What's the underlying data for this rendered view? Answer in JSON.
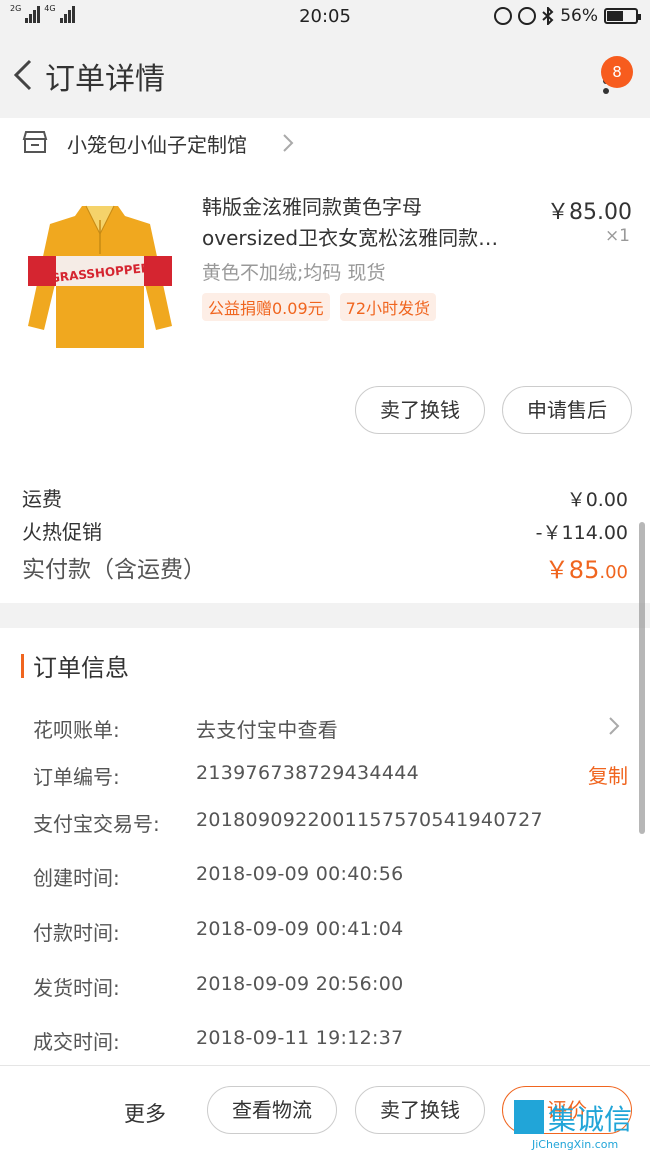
{
  "status_bar": {
    "network_1": "2G",
    "network_2": "4G",
    "time": "20:05",
    "battery": "56%",
    "battery_level": 0.56
  },
  "nav": {
    "title": "订单详情",
    "badge_count": "8"
  },
  "shop": {
    "name": "小笼包小仙子定制馆"
  },
  "product": {
    "title_line1": "韩版金泫雅同款黄色字母",
    "title_line2": "oversized卫衣女宽松泫雅同款…",
    "price": "￥85.00",
    "quantity": "×1",
    "spec": "黄色不加绒;均码 现货",
    "tags": [
      "公益捐赠0.09元",
      "72小时发货"
    ],
    "image_text": "GRASSHOPPER",
    "image_color": "#f0a81f"
  },
  "item_actions": {
    "sell_label": "卖了换钱",
    "after_sale_label": "申请售后"
  },
  "fees": {
    "shipping_label": "运费",
    "shipping_value": "￥0.00",
    "promo_label": "火热促销",
    "promo_value": "-￥114.00",
    "paid_label": "实付款（含运费）",
    "paid_value_main": "￥85",
    "paid_value_decimal": ".00"
  },
  "order_info": {
    "title": "订单信息",
    "rows": [
      {
        "label": "花呗账单:",
        "value": "去支付宝中查看"
      },
      {
        "label": "订单编号:",
        "value": "213976738729434444",
        "action": "复制"
      },
      {
        "label": "支付宝交易号:",
        "value": "2018090922001157570541940727"
      },
      {
        "label": "创建时间:",
        "value": "2018-09-09 00:40:56"
      },
      {
        "label": "付款时间:",
        "value": "2018-09-09 00:41:04"
      },
      {
        "label": "发货时间:",
        "value": "2018-09-09 20:56:00"
      },
      {
        "label": "成交时间:",
        "value": "2018-09-11 19:12:37"
      }
    ]
  },
  "bottom_bar": {
    "more_label": "更多",
    "logistics_label": "查看物流",
    "sell_label": "卖了换钱",
    "review_label": "评价"
  },
  "watermark": {
    "text": "集诚信",
    "subtext": "JiChengXin.com"
  },
  "colors": {
    "accent": "#f0651f",
    "badge": "#f75c1e",
    "background": "#f2f2f2"
  }
}
